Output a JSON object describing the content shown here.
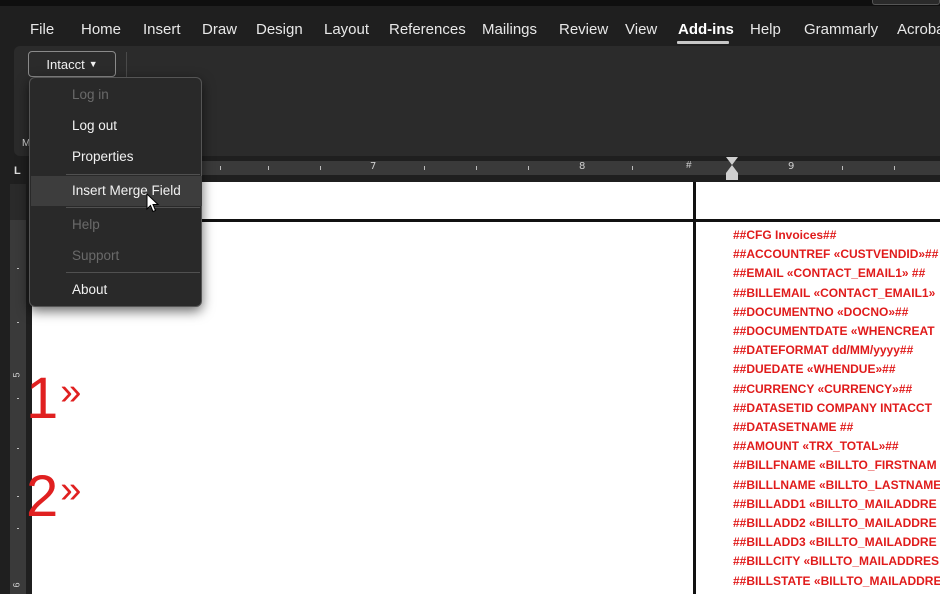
{
  "menubar": {
    "items": [
      "File",
      "Home",
      "Insert",
      "Draw",
      "Design",
      "Layout",
      "References",
      "Mailings",
      "Review",
      "View",
      "Add-ins",
      "Help",
      "Grammarly",
      "Acroba"
    ],
    "active": "Add-ins"
  },
  "ribbon": {
    "intacct_label": "Intacct",
    "partial_label": "M"
  },
  "dropdown": {
    "items": [
      {
        "label": "Log in",
        "enabled": false
      },
      {
        "label": "Log out",
        "enabled": true
      },
      {
        "label": "Properties",
        "enabled": true
      },
      {
        "label": "Insert Merge Field",
        "enabled": true,
        "hovered": true
      },
      {
        "label": "Help",
        "enabled": false
      },
      {
        "label": "Support",
        "enabled": false
      },
      {
        "label": "About",
        "enabled": true
      }
    ]
  },
  "ruler": {
    "numbers": [
      "7",
      "8",
      "9"
    ],
    "hash_label": "#",
    "tab_stop": "L",
    "vertical_numbers": [
      "5",
      "6"
    ]
  },
  "document": {
    "step_labels": [
      "1",
      "2"
    ],
    "merge_fields": [
      "##CFG Invoices##",
      "##ACCOUNTREF «CUSTVENDID»##",
      "##EMAIL «CONTACT_EMAIL1» ##",
      "##BILLEMAIL «CONTACT_EMAIL1»",
      "##DOCUMENTNO «DOCNO»##",
      "##DOCUMENTDATE «WHENCREAT",
      "##DATEFORMAT dd/MM/yyyy##",
      "##DUEDATE «WHENDUE»##",
      "##CURRENCY «CURRENCY»##",
      "##DATASETID COMPANY INTACCT",
      "##DATASETNAME ##",
      "##AMOUNT «TRX_TOTAL»##",
      "##BILLFNAME «BILLTO_FIRSTNAM",
      "##BILLLNAME «BILLTO_LASTNAME",
      "##BILLADD1 «BILLTO_MAILADDRE",
      "##BILLADD2 «BILLTO_MAILADDRE",
      "##BILLADD3 «BILLTO_MAILADDRE",
      "##BILLCITY «BILLTO_MAILADDRES",
      "##BILLSTATE «BILLTO_MAILADDRE"
    ]
  },
  "colors": {
    "accent_red": "#e01b1b",
    "menu_bg": "#292929"
  }
}
